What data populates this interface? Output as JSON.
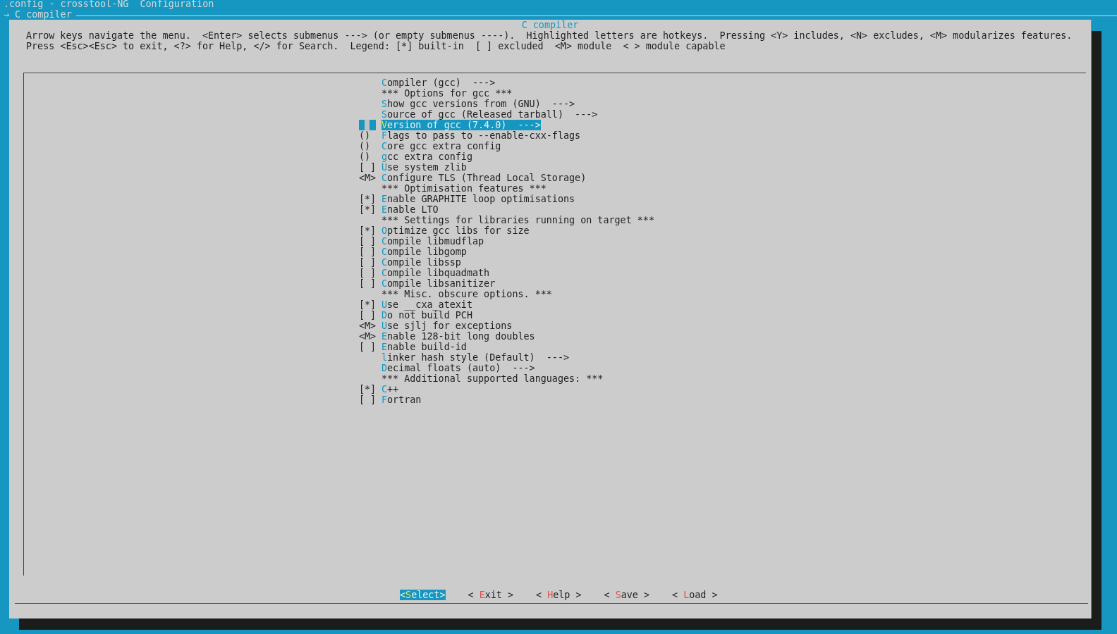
{
  "header": {
    "title": ".config - crosstool-NG  Configuration",
    "breadcrumb": "→ C compiler"
  },
  "dialog": {
    "title": "C compiler",
    "help": [
      "Arrow keys navigate the menu.  <Enter> selects submenus ---> (or empty submenus ----).  Highlighted letters are hotkeys.  Pressing <Y> includes, <N> excludes, <M> modularizes features.",
      "Press <Esc><Esc> to exit, <?> for Help, </> for Search.  Legend: [*] built-in  [ ] excluded  <M> module  < > module capable"
    ]
  },
  "menu": [
    {
      "kind": "option",
      "label": "Compiler (gcc)  --->",
      "selected": false
    },
    {
      "kind": "comment",
      "label": "*** Options for gcc ***",
      "selected": false
    },
    {
      "kind": "option",
      "label": "Show gcc versions from (GNU)  --->",
      "selected": false
    },
    {
      "kind": "option",
      "label": "Source of gcc (Released tarball)  --->",
      "selected": false
    },
    {
      "kind": "option",
      "label": "Version of gcc (7.4.0)  --->",
      "selected": true
    },
    {
      "kind": "option",
      "prefix": "()",
      "label": "Flags to pass to --enable-cxx-flags",
      "selected": false
    },
    {
      "kind": "option",
      "prefix": "()",
      "label": "Core gcc extra config",
      "selected": false
    },
    {
      "kind": "option",
      "prefix": "()",
      "label": "gcc extra config",
      "selected": false
    },
    {
      "kind": "option",
      "prefix": "[ ]",
      "label": "Use system zlib",
      "selected": false
    },
    {
      "kind": "option",
      "prefix": "<M>",
      "label": "Configure TLS (Thread Local Storage)",
      "selected": false
    },
    {
      "kind": "comment",
      "label": "*** Optimisation features ***",
      "selected": false
    },
    {
      "kind": "option",
      "prefix": "[*]",
      "label": "Enable GRAPHITE loop optimisations",
      "selected": false
    },
    {
      "kind": "option",
      "prefix": "[*]",
      "label": "Enable LTO",
      "selected": false
    },
    {
      "kind": "comment",
      "label": "*** Settings for libraries running on target ***",
      "selected": false
    },
    {
      "kind": "option",
      "prefix": "[*]",
      "label": "Optimize gcc libs for size",
      "selected": false
    },
    {
      "kind": "option",
      "prefix": "[ ]",
      "label": "Compile libmudflap",
      "selected": false
    },
    {
      "kind": "option",
      "prefix": "[ ]",
      "label": "Compile libgomp",
      "selected": false
    },
    {
      "kind": "option",
      "prefix": "[ ]",
      "label": "Compile libssp",
      "selected": false
    },
    {
      "kind": "option",
      "prefix": "[ ]",
      "label": "Compile libquadmath",
      "selected": false
    },
    {
      "kind": "option",
      "prefix": "[ ]",
      "label": "Compile libsanitizer",
      "selected": false
    },
    {
      "kind": "comment",
      "label": "*** Misc. obscure options. ***",
      "selected": false
    },
    {
      "kind": "option",
      "prefix": "[*]",
      "label": "Use __cxa_atexit",
      "selected": false
    },
    {
      "kind": "option",
      "prefix": "[ ]",
      "label": "Do not build PCH",
      "selected": false
    },
    {
      "kind": "option",
      "prefix": "<M>",
      "label": "Use sjlj for exceptions",
      "selected": false
    },
    {
      "kind": "option",
      "prefix": "<M>",
      "label": "Enable 128-bit long doubles",
      "selected": false
    },
    {
      "kind": "option",
      "prefix": "[ ]",
      "label": "Enable build-id",
      "selected": false
    },
    {
      "kind": "option",
      "label": "linker hash style (Default)  --->",
      "selected": false
    },
    {
      "kind": "option",
      "label": "Decimal floats (auto)  --->",
      "selected": false
    },
    {
      "kind": "comment",
      "label": "*** Additional supported languages: ***",
      "selected": false
    },
    {
      "kind": "option",
      "prefix": "[*]",
      "label": "C++",
      "selected": false
    },
    {
      "kind": "option",
      "prefix": "[ ]",
      "label": "Fortran",
      "selected": false
    }
  ],
  "buttons": [
    {
      "label": "<Select>",
      "selected": true
    },
    {
      "label": "< Exit >",
      "selected": false
    },
    {
      "label": "< Help >",
      "selected": false
    },
    {
      "label": "< Save >",
      "selected": false
    },
    {
      "label": "< Load >",
      "selected": false
    }
  ]
}
